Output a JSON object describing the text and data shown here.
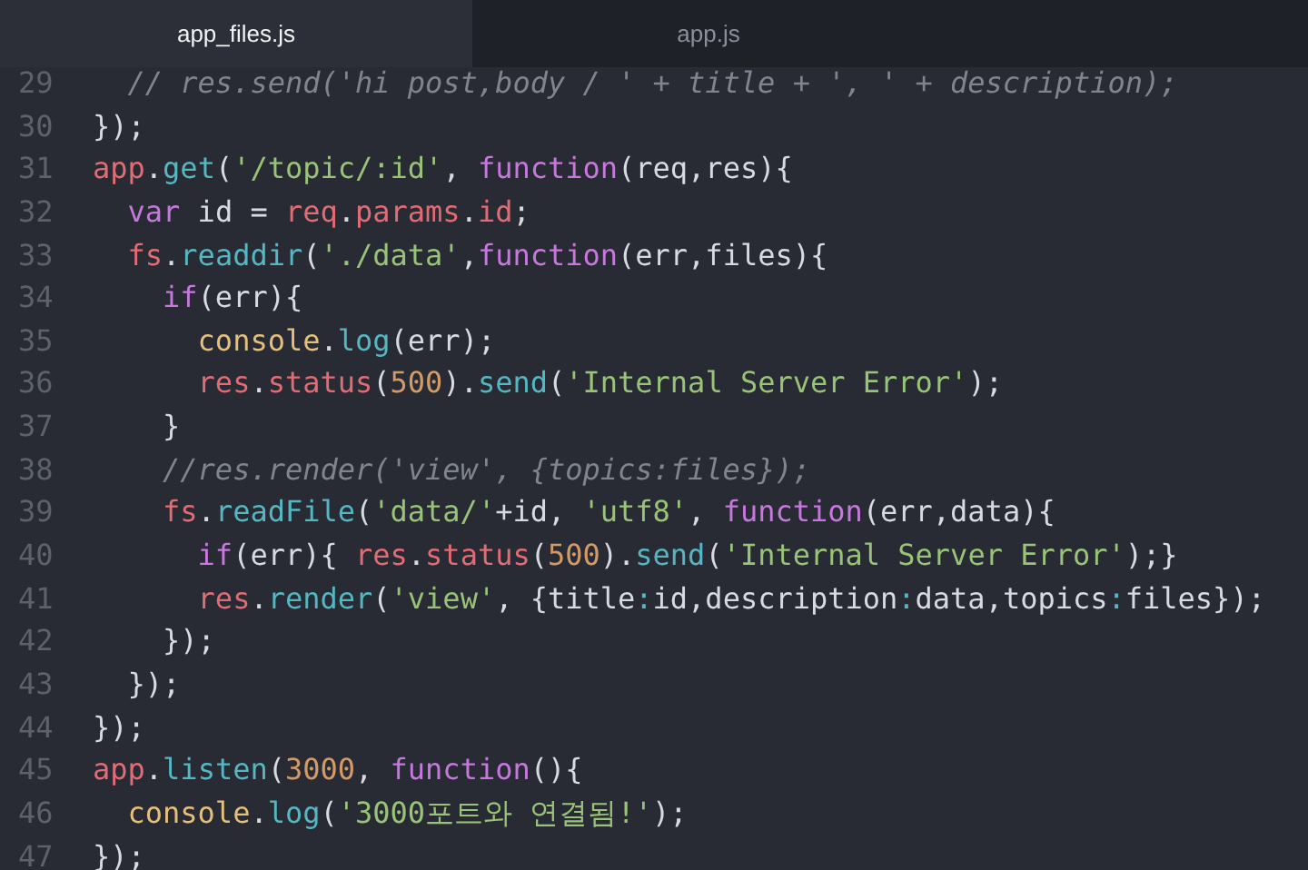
{
  "tabs": [
    {
      "label": "app_files.js",
      "selected": true
    },
    {
      "label": "app.js",
      "selected": false
    }
  ],
  "lines": [
    {
      "number": "29",
      "tokens": [
        {
          "kind": "comment",
          "text": "  // res.send('hi post,body / ' + title + ', ' + description);"
        }
      ]
    },
    {
      "number": "30",
      "tokens": [
        {
          "kind": "plain",
          "text": "});"
        }
      ]
    },
    {
      "number": "31",
      "tokens": [
        {
          "kind": "object",
          "text": "app"
        },
        {
          "kind": "plain",
          "text": "."
        },
        {
          "kind": "method",
          "text": "get"
        },
        {
          "kind": "plain",
          "text": "("
        },
        {
          "kind": "string",
          "text": "'/topic/:id'"
        },
        {
          "kind": "plain",
          "text": ", "
        },
        {
          "kind": "keyword",
          "text": "function"
        },
        {
          "kind": "plain",
          "text": "(req,res){"
        }
      ]
    },
    {
      "number": "32",
      "tokens": [
        {
          "kind": "keyword",
          "text": "  var"
        },
        {
          "kind": "plain",
          "text": " id = "
        },
        {
          "kind": "object",
          "text": "req"
        },
        {
          "kind": "plain",
          "text": "."
        },
        {
          "kind": "object",
          "text": "params"
        },
        {
          "kind": "plain",
          "text": "."
        },
        {
          "kind": "object",
          "text": "id"
        },
        {
          "kind": "plain",
          "text": ";"
        }
      ]
    },
    {
      "number": "33",
      "tokens": [
        {
          "kind": "object",
          "text": "  fs"
        },
        {
          "kind": "method",
          "text": ".readdir"
        },
        {
          "kind": "plain",
          "text": "("
        },
        {
          "kind": "string",
          "text": "'./data'"
        },
        {
          "kind": "keyword",
          "text": ",function"
        },
        {
          "kind": "plain",
          "text": "(err,files){"
        }
      ]
    },
    {
      "number": "34",
      "tokens": [
        {
          "kind": "keyword",
          "text": "    if"
        },
        {
          "kind": "plain",
          "text": "(err){"
        }
      ]
    },
    {
      "number": "35",
      "tokens": [
        {
          "kind": "builtin",
          "text": "      console"
        },
        {
          "kind": "method",
          "text": ".log"
        },
        {
          "kind": "plain",
          "text": "(err);"
        }
      ]
    },
    {
      "number": "36",
      "tokens": [
        {
          "kind": "object",
          "text": "      res"
        },
        {
          "kind": "plain",
          "text": "."
        },
        {
          "kind": "object",
          "text": "status"
        },
        {
          "kind": "plain",
          "text": "("
        },
        {
          "kind": "number",
          "text": "500"
        },
        {
          "kind": "plain",
          "text": ")."
        },
        {
          "kind": "method",
          "text": "send"
        },
        {
          "kind": "plain",
          "text": "("
        },
        {
          "kind": "string",
          "text": "'Internal Server Error'"
        },
        {
          "kind": "plain",
          "text": ");"
        }
      ]
    },
    {
      "number": "37",
      "tokens": [
        {
          "kind": "plain",
          "text": "    }"
        }
      ]
    },
    {
      "number": "38",
      "tokens": [
        {
          "kind": "comment",
          "text": "    //res.render('view', {topics:files});"
        }
      ]
    },
    {
      "number": "39",
      "tokens": [
        {
          "kind": "object",
          "text": "    fs"
        },
        {
          "kind": "method",
          "text": ".readFile"
        },
        {
          "kind": "plain",
          "text": "("
        },
        {
          "kind": "string",
          "text": "'data/'"
        },
        {
          "kind": "plain",
          "text": "+id, "
        },
        {
          "kind": "string",
          "text": "'utf8'"
        },
        {
          "kind": "plain",
          "text": ", "
        },
        {
          "kind": "keyword",
          "text": "function"
        },
        {
          "kind": "plain",
          "text": "(err,data){"
        }
      ]
    },
    {
      "number": "40",
      "tokens": [
        {
          "kind": "keyword",
          "text": "      if"
        },
        {
          "kind": "plain",
          "text": "(err){ "
        },
        {
          "kind": "object",
          "text": "res"
        },
        {
          "kind": "plain",
          "text": "."
        },
        {
          "kind": "object",
          "text": "status"
        },
        {
          "kind": "plain",
          "text": "("
        },
        {
          "kind": "number",
          "text": "500"
        },
        {
          "kind": "plain",
          "text": ")."
        },
        {
          "kind": "method",
          "text": "send"
        },
        {
          "kind": "plain",
          "text": "("
        },
        {
          "kind": "string",
          "text": "'Internal Server Error'"
        },
        {
          "kind": "plain",
          "text": ");}"
        }
      ]
    },
    {
      "number": "41",
      "tokens": [
        {
          "kind": "object",
          "text": "      res"
        },
        {
          "kind": "plain",
          "text": "."
        },
        {
          "kind": "method",
          "text": "render"
        },
        {
          "kind": "plain",
          "text": "("
        },
        {
          "kind": "string",
          "text": "'view'"
        },
        {
          "kind": "plain",
          "text": ", {title"
        },
        {
          "kind": "operator",
          "text": ":"
        },
        {
          "kind": "plain",
          "text": "id,description"
        },
        {
          "kind": "operator",
          "text": ":"
        },
        {
          "kind": "plain",
          "text": "data,topics"
        },
        {
          "kind": "operator",
          "text": ":"
        },
        {
          "kind": "plain",
          "text": "files});"
        }
      ]
    },
    {
      "number": "42",
      "tokens": [
        {
          "kind": "plain",
          "text": "    });"
        }
      ]
    },
    {
      "number": "43",
      "tokens": [
        {
          "kind": "plain",
          "text": "  });"
        }
      ]
    },
    {
      "number": "44",
      "tokens": [
        {
          "kind": "plain",
          "text": "});"
        }
      ]
    },
    {
      "number": "45",
      "tokens": [
        {
          "kind": "object",
          "text": "app"
        },
        {
          "kind": "plain",
          "text": "."
        },
        {
          "kind": "method",
          "text": "listen"
        },
        {
          "kind": "plain",
          "text": "("
        },
        {
          "kind": "number",
          "text": "3000"
        },
        {
          "kind": "plain",
          "text": ", "
        },
        {
          "kind": "keyword",
          "text": "function"
        },
        {
          "kind": "plain",
          "text": "(){"
        }
      ]
    },
    {
      "number": "46",
      "tokens": [
        {
          "kind": "builtin",
          "text": "  console"
        },
        {
          "kind": "plain",
          "text": "."
        },
        {
          "kind": "method",
          "text": "log"
        },
        {
          "kind": "plain",
          "text": "("
        },
        {
          "kind": "string",
          "text": "'3000포트와 연결됨!'"
        },
        {
          "kind": "plain",
          "text": ");"
        }
      ]
    },
    {
      "number": "47",
      "tokens": [
        {
          "kind": "plain",
          "text": "});"
        }
      ]
    }
  ]
}
